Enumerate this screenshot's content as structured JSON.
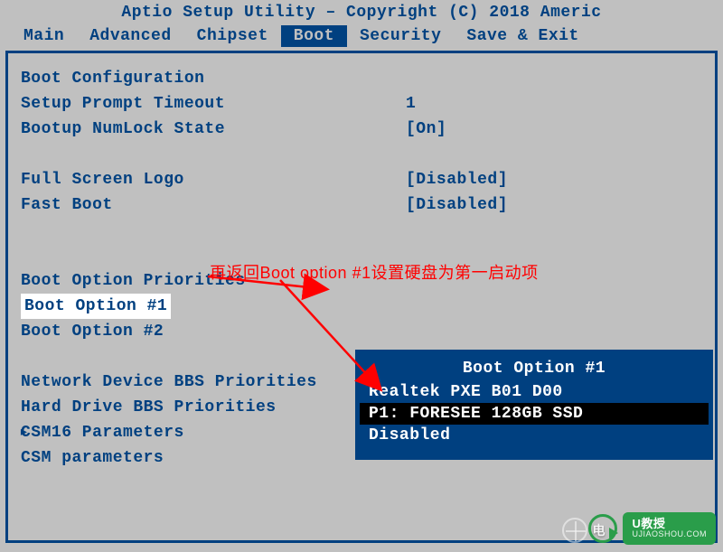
{
  "title": "Aptio Setup Utility – Copyright (C) 2018 Americ",
  "menu": {
    "items": [
      "Main",
      "Advanced",
      "Chipset",
      "Boot",
      "Security",
      "Save & Exit"
    ],
    "active_index": 3
  },
  "section_header": "Boot Configuration",
  "settings": [
    {
      "label": "Setup Prompt Timeout",
      "value": "1"
    },
    {
      "label": "Bootup NumLock State",
      "value": "[On]"
    }
  ],
  "settings2": [
    {
      "label": "Full Screen Logo",
      "value": "[Disabled]"
    },
    {
      "label": "Fast Boot",
      "value": "[Disabled]"
    }
  ],
  "priorities_header": "Boot Option Priorities",
  "boot_options": [
    {
      "label": "Boot Option #1",
      "value": "[P1: FORESEE 128GB S...]",
      "selected": true
    },
    {
      "label": "Boot Option #2",
      "value": ""
    }
  ],
  "submenus": [
    "Network Device BBS Priorities",
    "Hard Drive BBS Priorities",
    "CSM16 Parameters",
    "CSM parameters"
  ],
  "popup": {
    "title": "Boot Option #1",
    "items": [
      "Realtek PXE B01 D00",
      "P1: FORESEE 128GB SSD",
      "Disabled"
    ],
    "selected_index": 1
  },
  "annotation_text": "再返回Boot option #1设置硬盘为第一启动项",
  "watermark": {
    "brand": "U教授",
    "site": "UJIAOSHOU.COM",
    "left_text": "电"
  }
}
